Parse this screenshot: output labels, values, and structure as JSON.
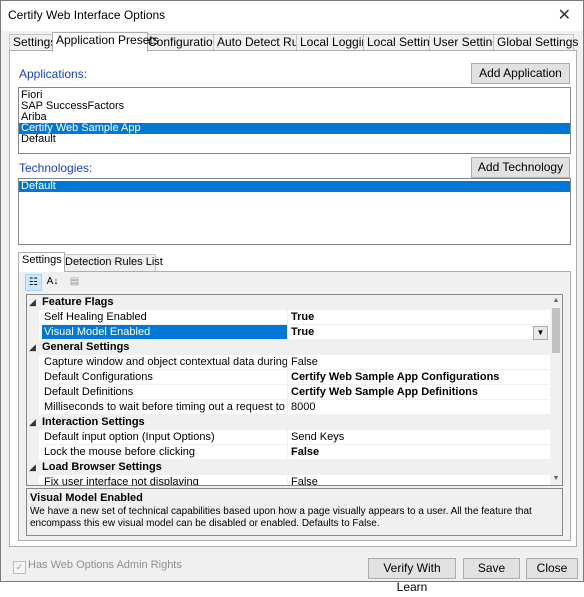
{
  "window": {
    "title": "Certify Web Interface Options",
    "close_glyph": "✕"
  },
  "tabs": [
    "Settings",
    "Application Presets",
    "Configuration",
    "Auto Detect Rules",
    "Local Logging",
    "Local Settings",
    "User Settings",
    "Global Settings"
  ],
  "active_tab": "Application Presets",
  "applications": {
    "label": "Applications:",
    "add_button": "Add Application",
    "items": [
      "Fiori",
      "SAP SuccessFactors",
      "Ariba",
      "Certify Web Sample App",
      "Default"
    ],
    "selected": "Certify Web Sample App"
  },
  "technologies": {
    "label": "Technologies:",
    "add_button": "Add Technology",
    "items": [
      "Default"
    ],
    "selected": "Default"
  },
  "inner_tabs": [
    "Settings",
    "Detection Rules List"
  ],
  "toolbar": {
    "categorized_glyph": "☷",
    "alpha_glyph": "A↓",
    "pages_glyph": "▤"
  },
  "grid": {
    "categories": [
      {
        "name": "Feature Flags",
        "props": [
          {
            "name": "Self Healing Enabled",
            "value": "True",
            "bold": true
          },
          {
            "name": "Visual Model Enabled",
            "value": "True",
            "bold": true,
            "selected": true
          }
        ]
      },
      {
        "name": "General Settings",
        "props": [
          {
            "name": "Capture window and object contextual data during learn (M",
            "value": "False",
            "bold": false
          },
          {
            "name": "Default Configurations",
            "value": "Certify Web Sample App Configurations",
            "bold": true
          },
          {
            "name": "Default Definitions",
            "value": "Certify Web Sample App Definitions",
            "bold": true
          },
          {
            "name": "Milliseconds to wait before timing out a request to the brov",
            "value": "8000",
            "bold": false
          }
        ]
      },
      {
        "name": "Interaction Settings",
        "props": [
          {
            "name": "Default input option (Input Options)",
            "value": "Send Keys",
            "bold": false
          },
          {
            "name": "Lock the mouse before clicking",
            "value": "False",
            "bold": true
          }
        ]
      },
      {
        "name": "Load Browser Settings",
        "props": [
          {
            "name": "Fix user interface not displaying",
            "value": "False",
            "bold": false
          }
        ]
      }
    ],
    "collapse_glyph": "◢"
  },
  "description": {
    "title": "Visual Model Enabled",
    "text": "We have a new set of technical capabilities based upon how a page visually appears to a user.  All the feature that encompass this ew visual model can be disabled or enabled. Defaults to False."
  },
  "footer": {
    "checkbox_label": "Has Web Options Admin Rights",
    "checked": true,
    "verify_button": "Verify With Learn",
    "save_button": "Save",
    "close_button": "Close"
  }
}
